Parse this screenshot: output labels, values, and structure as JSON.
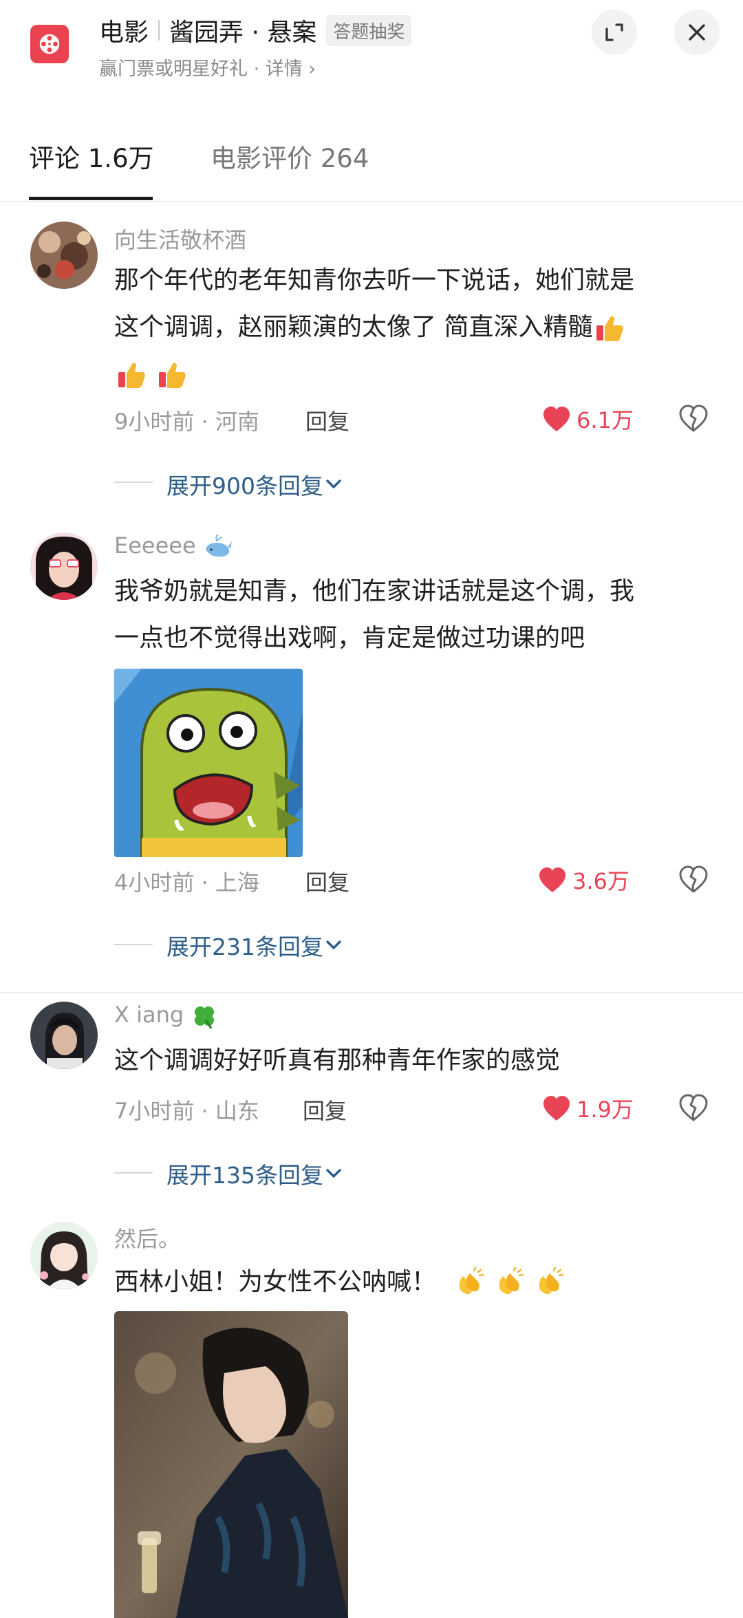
{
  "header": {
    "category": "电影",
    "title": "酱园弄 · 悬案",
    "quiz_tag": "答题抽奖",
    "subtitle": "赢门票或明星好礼 · 详情 ›"
  },
  "tabs": [
    {
      "label": "评论 1.6万",
      "active": true
    },
    {
      "label": "电影评价 264",
      "active": false
    }
  ],
  "comments": [
    {
      "username": "向生活敬杯酒",
      "text_line1": "那个年代的老年知青你去听一下说话，她们就是",
      "text_line2": "这个调调，赵丽颖演的太像了 简直深入精髓",
      "emoji_icons": [
        "thumbs-up-icon",
        "thumbs-up-icon",
        "thumbs-up-icon"
      ],
      "meta": "9小时前 · 河南",
      "reply_label": "回复",
      "likes": "6.1万",
      "expand_label": "展开900条回复"
    },
    {
      "username": "Eeeeee",
      "username_icon": "whale-icon",
      "text_line1": "我爷奶就是知青，他们在家讲话就是这个调，我",
      "text_line2": "一点也不觉得出戏啊，肯定是做过功课的吧",
      "image": "surprised-green-fish-sticker",
      "meta": "4小时前 · 上海",
      "reply_label": "回复",
      "likes": "3.6万",
      "expand_label": "展开231条回复"
    },
    {
      "username": "X iang",
      "username_icon": "four-leaf-clover-icon",
      "text_line1": "这个调调好好听真有那种青年作家的感觉",
      "meta": "7小时前 · 山东",
      "reply_label": "回复",
      "likes": "1.9万",
      "expand_label": "展开135条回复"
    },
    {
      "username": "然后。",
      "text_line1": "西林小姐！为女性不公呐喊！",
      "emoji_icons": [
        "clapping-hands-icon",
        "clapping-hands-icon",
        "clapping-hands-icon"
      ],
      "image": "woman-short-hair-champagne-photo"
    }
  ],
  "colors": {
    "accent_red": "#e94356",
    "logo_red": "#e9434f",
    "link_blue": "#2c5d8a"
  }
}
